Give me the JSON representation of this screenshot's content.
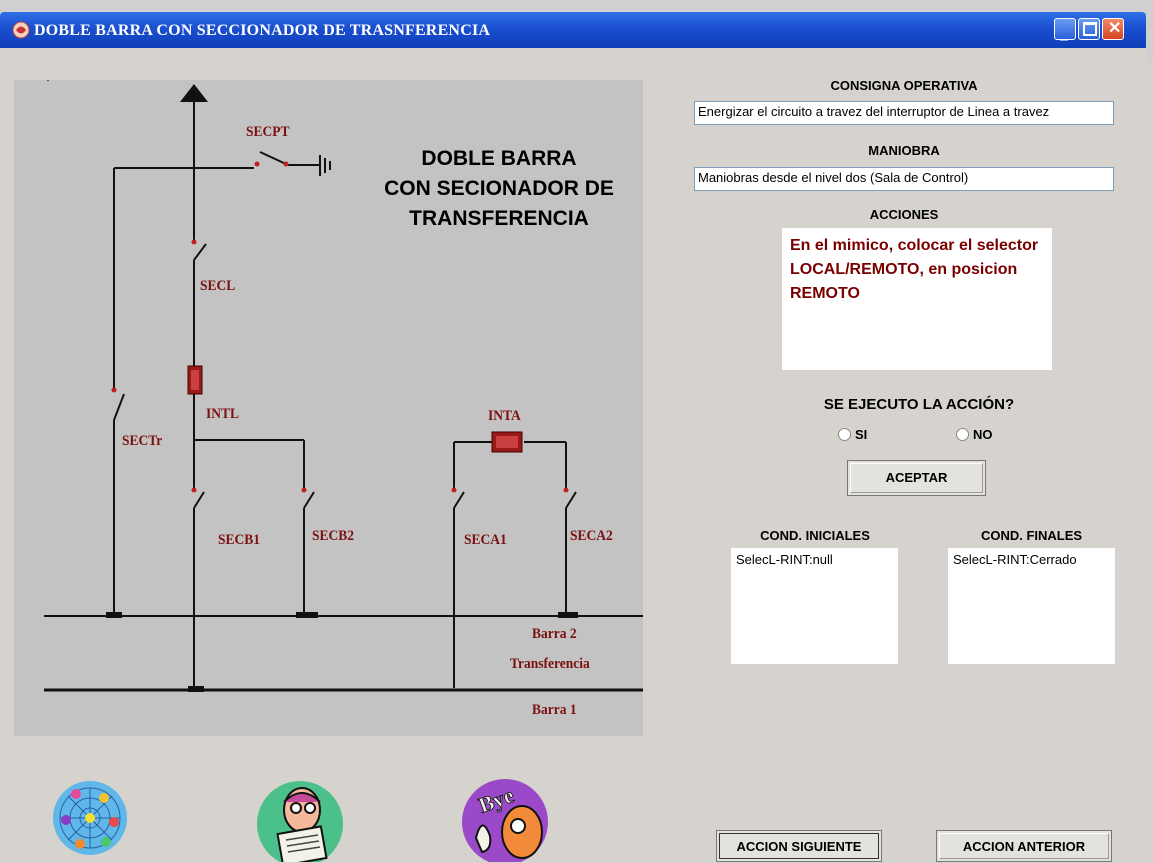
{
  "window": {
    "title": "DOBLE BARRA CON SECCIONADOR DE TRASNFERENCIA"
  },
  "diagram": {
    "title_lines": [
      "DOBLE BARRA",
      "CON SECIONADOR DE",
      "TRANSFERENCIA"
    ],
    "labels": {
      "secpt": "SECPT",
      "secl": "SECL",
      "intl": "INTL",
      "sectr": "SECTr",
      "inta": "INTA",
      "secb1": "SECB1",
      "secb2": "SECB2",
      "seca1": "SECA1",
      "seca2": "SECA2",
      "barra2": "Barra  2",
      "transferencia": "Transferencia",
      "barra1": "Barra  1"
    }
  },
  "panel": {
    "consigna_label": "CONSIGNA OPERATIVA",
    "consigna_value": "Energizar  el circuito a travez del interruptor de Linea a travez",
    "maniobra_label": "MANIOBRA",
    "maniobra_value": "Maniobras desde el nivel dos  (Sala de Control)",
    "acciones_label": "ACCIONES",
    "acciones_text": "En el mimico, colocar el selector LOCAL/REMOTO, en posicion REMOTO",
    "question": "SE EJECUTO LA ACCIÓN?",
    "option_si": "SI",
    "option_no": "NO",
    "aceptar": "ACEPTAR",
    "cond_iniciales_label": "COND. INICIALES",
    "cond_iniciales_value": "SelecL-RINT:null",
    "cond_finales_label": "COND. FINALES",
    "cond_finales_value": "SelecL-RINT:Cerrado"
  },
  "footer": {
    "next_button": "ACCION SIGUIENTE",
    "prev_button": "ACCION ANTERIOR",
    "bye_text": "Bye"
  },
  "icons": [
    "network-people-icon",
    "reading-person-icon",
    "bye-icon"
  ]
}
